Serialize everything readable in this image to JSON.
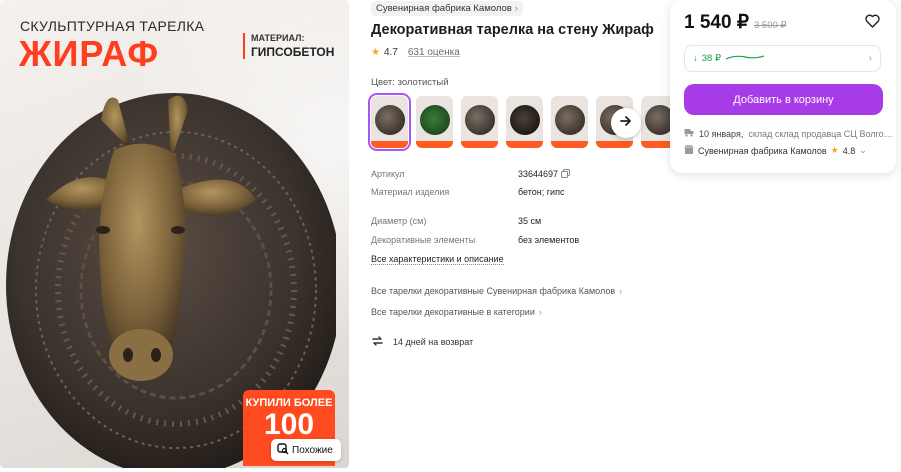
{
  "image": {
    "promo_subtitle": "СКУЛЬПТУРНАЯ ТАРЕЛКА",
    "promo_title": "ЖИРАФ",
    "material_label": "МАТЕРИАЛ:",
    "material_value": "ГИПСОБЕТОН",
    "badge_line1": "КУПИЛИ БОЛЕЕ",
    "badge_line2": "100",
    "similar_label": "Похожие"
  },
  "product": {
    "brand_chip": "Сувенирная фабрика Камолов",
    "title": "Декоративная тарелка на стену Жираф",
    "rating": "4.7",
    "reviews": "631 оценка",
    "color_label": "Цвет: золотистый",
    "thumb_count": 7
  },
  "specs": [
    {
      "key": "Артикул",
      "value": "33644697"
    },
    {
      "key": "Материал изделия",
      "value": "бетон; гипс"
    },
    {
      "key": "Диаметр (см)",
      "value": "35 см"
    },
    {
      "key": "Декоративные элементы",
      "value": "без элементов"
    }
  ],
  "links": {
    "all_chars": "Все характеристики и описание",
    "brand_all": "Все тарелки декоративные Сувенирная фабрика Камолов",
    "category_all": "Все тарелки декоративные в категории",
    "returns": "14 дней на возврат"
  },
  "buy": {
    "price": "1 540 ₽",
    "old_price": "3 500 ₽",
    "points": "38 ₽",
    "cart_button": "Добавить в корзину",
    "delivery_date": "10 января,",
    "delivery_place": "склад склад продавца СЦ Волго…",
    "seller": "Сувенирная фабрика Камолов",
    "seller_rating": "4.8"
  },
  "colors": {
    "accent": "#a83be8",
    "promo_red": "#ff3d1f",
    "green": "#17a34a"
  }
}
